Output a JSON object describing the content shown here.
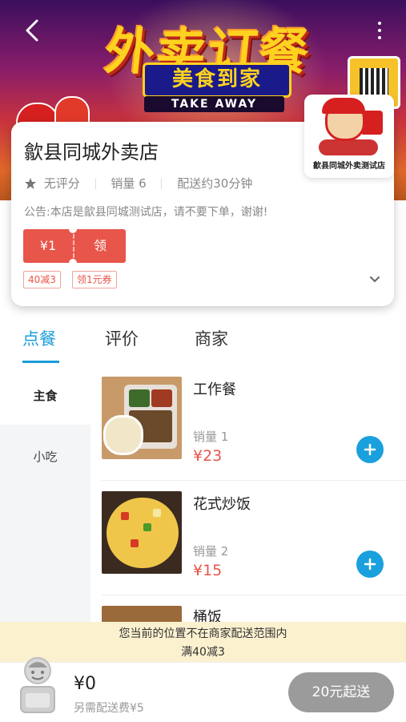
{
  "banner": {
    "title": "外卖订餐",
    "ribbon": "美食到家",
    "takeaway": "TAKE AWAY"
  },
  "shop": {
    "name": "歙县同城外卖店",
    "logo_text": "歙县同城外卖测试店",
    "rating": "无评分",
    "sales": "销量 6",
    "delivery_time": "配送约30分钟",
    "notice": "公告:本店是歙县同城测试店，请不要下单，谢谢!",
    "coupon": {
      "amount": "¥1",
      "action": "领"
    },
    "tags": [
      "40减3",
      "领1元券"
    ]
  },
  "tabs": [
    "点餐",
    "评价",
    "商家"
  ],
  "active_tab": "点餐",
  "categories": [
    "主食",
    "小吃"
  ],
  "active_category": "主食",
  "foods": [
    {
      "name": "工作餐",
      "sales": "销量 1",
      "price": "¥23"
    },
    {
      "name": "花式炒饭",
      "sales": "销量 2",
      "price": "¥15"
    },
    {
      "name": "桶饭"
    }
  ],
  "delivery_notice": {
    "line1": "您当前的位置不在商家配送范围内",
    "line2": "满40减3"
  },
  "cart": {
    "total": "¥0",
    "delivery_fee": "另需配送费¥5",
    "checkout_label": "20元起送"
  },
  "colors": {
    "accent": "#1a9ed8",
    "price": "#e8554a",
    "checkout_disabled": "#9b9b9b",
    "notice_bg": "#fbf1cf"
  }
}
